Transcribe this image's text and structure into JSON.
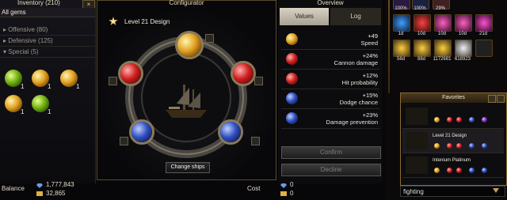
{
  "inventory": {
    "title": "Inventory (210)",
    "close_glyph": "×",
    "filter": "All gems",
    "categories": [
      {
        "label": "Offensive (80)",
        "arrow": "▸"
      },
      {
        "label": "Defensive (125)",
        "arrow": "▸"
      },
      {
        "label": "Special (5)",
        "arrow": "▾"
      }
    ],
    "gems": [
      {
        "count": "1",
        "icon": "green-gem-icon"
      },
      {
        "count": "1",
        "icon": "gold-gem-icon"
      },
      {
        "count": "1",
        "icon": "gold-gem-icon"
      },
      {
        "count": "1",
        "icon": "gold-gem-icon"
      },
      {
        "count": "1",
        "icon": "gold-green-gem-icon"
      }
    ]
  },
  "configurator": {
    "title": "Configurator",
    "design_name": "Level 21 Design",
    "change_ships_label": "Change ships",
    "sockets": [
      "gold",
      "red",
      "red",
      "blue",
      "blue"
    ]
  },
  "overview": {
    "title": "Overview",
    "tabs": [
      "Values",
      "Log"
    ],
    "rows": [
      {
        "value": "+49",
        "label": "Speed",
        "gem": "gold"
      },
      {
        "value": "+24%",
        "label": "Cannon damage",
        "gem": "red"
      },
      {
        "value": "+12%",
        "label": "Hit probability",
        "gem": "red"
      },
      {
        "value": "+15%",
        "label": "Dodge chance",
        "gem": "blue"
      },
      {
        "value": "+23%",
        "label": "Damage prevention",
        "gem": "blue"
      }
    ],
    "confirm_label": "Confirm",
    "decline_label": "Decline"
  },
  "footer": {
    "balance_label": "Balance",
    "balance_gems": "1,777,843",
    "balance_gold": "32,865",
    "cost_label": "Cost",
    "cost_gems": "0",
    "cost_gold": "0"
  },
  "resources": {
    "row1_labels": [
      "100%",
      "100%",
      "29%"
    ],
    "row2_labels": [
      "1d",
      "10d",
      "10d",
      "10d",
      "21d"
    ],
    "row3_labels": [
      "56d",
      "88d",
      "1172681",
      "618923"
    ]
  },
  "favorites": {
    "title": "Favorites",
    "entries": [
      "",
      "Level 21 Design",
      "Intenium Platinum"
    ]
  },
  "search": {
    "value": "fighting"
  },
  "colors": {
    "accent": "#c8a050",
    "panel_border": "#5a4a2a"
  }
}
